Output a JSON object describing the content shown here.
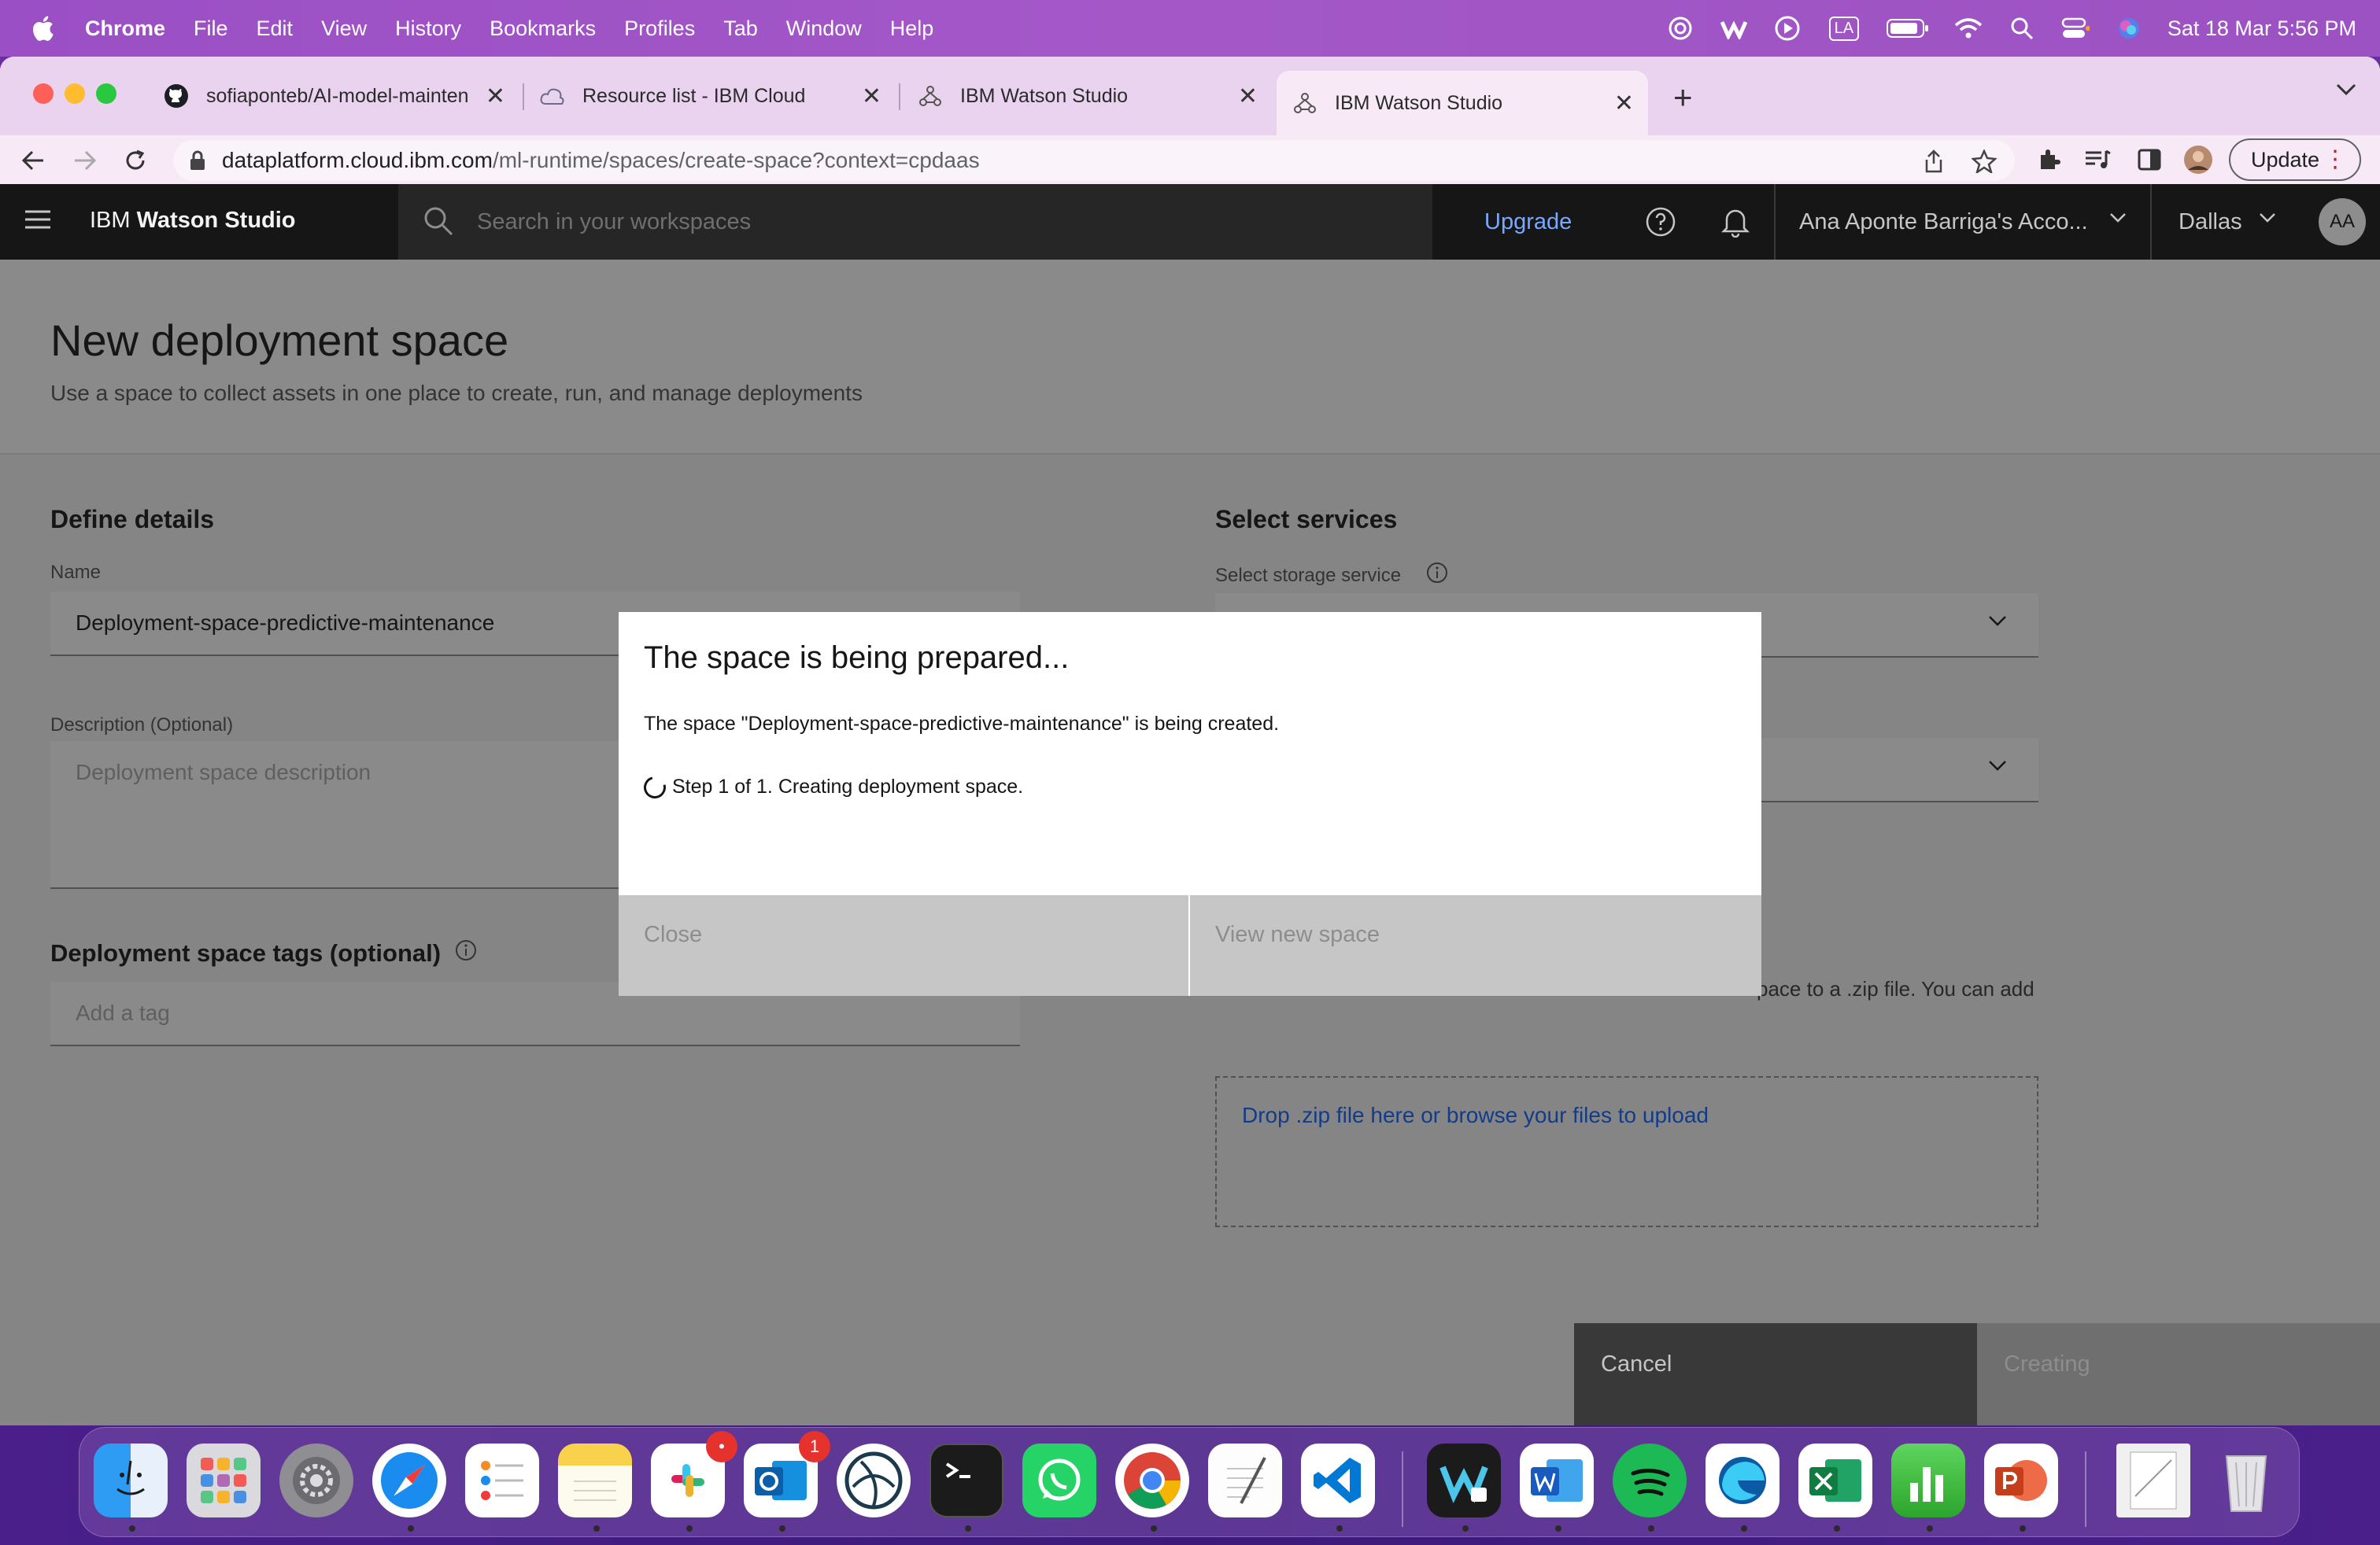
{
  "menubar": {
    "app": "Chrome",
    "items": [
      "File",
      "Edit",
      "View",
      "History",
      "Bookmarks",
      "Profiles",
      "Tab",
      "Window",
      "Help"
    ],
    "input_badge": "LA",
    "datetime": "Sat 18 Mar  5:56 PM"
  },
  "tabs": [
    {
      "title": "sofiaponteb/AI-model-mainten",
      "icon": "github-icon"
    },
    {
      "title": "Resource list - IBM Cloud",
      "icon": "ibm-cloud-icon"
    },
    {
      "title": "IBM Watson Studio",
      "icon": "watson-icon"
    },
    {
      "title": "IBM Watson Studio",
      "icon": "watson-icon",
      "active": true
    }
  ],
  "address": {
    "host": "dataplatform.cloud.ibm.com",
    "path": "/ml-runtime/spaces/create-space?context=cpdaas"
  },
  "toolbar": {
    "update_label": "Update"
  },
  "header": {
    "brand_prefix": "IBM ",
    "brand_name": "Watson Studio",
    "search_placeholder": "Search in your workspaces",
    "upgrade": "Upgrade",
    "account": "Ana Aponte Barriga's Acco...",
    "region": "Dallas",
    "avatar": "AA"
  },
  "page": {
    "title": "New deployment space",
    "subtitle": "Use a space to collect assets in one place to create, run, and manage deployments",
    "define_details": "Define details",
    "name_label": "Name",
    "name_value": "Deployment-space-predictive-maintenance",
    "description_label": "Description (Optional)",
    "description_placeholder": "Deployment space description",
    "tags_heading": "Deployment space tags (optional)",
    "tags_placeholder": "Add a tag",
    "select_services": "Select services",
    "storage_label": "Select storage service",
    "zip_helper_fragment": "pace to a .zip file. You can add",
    "dropzone_text": "Drop .zip file here or browse your files to upload",
    "cancel": "Cancel",
    "creating": "Creating"
  },
  "modal": {
    "title": "The space is being prepared...",
    "body": "The space \"Deployment-space-predictive-maintenance\" is being created.",
    "step": "Step 1 of 1. Creating deployment space.",
    "close": "Close",
    "view": "View new space"
  },
  "dock": {
    "apps": [
      "finder",
      "launchpad",
      "system-settings",
      "safari",
      "reminders",
      "notes",
      "slack",
      "outlook",
      "lens",
      "terminal",
      "whatsapp",
      "chrome",
      "textedit",
      "vscode",
      "webex",
      "word",
      "spotify",
      "edge",
      "excel",
      "numbers",
      "powerpoint",
      "preview",
      "trash"
    ],
    "outlook_badge": "1",
    "slack_badge": "•"
  },
  "colors": {
    "accent": "#0f62fe",
    "header_bg": "#161616",
    "menubar": "#9a4fc4"
  }
}
